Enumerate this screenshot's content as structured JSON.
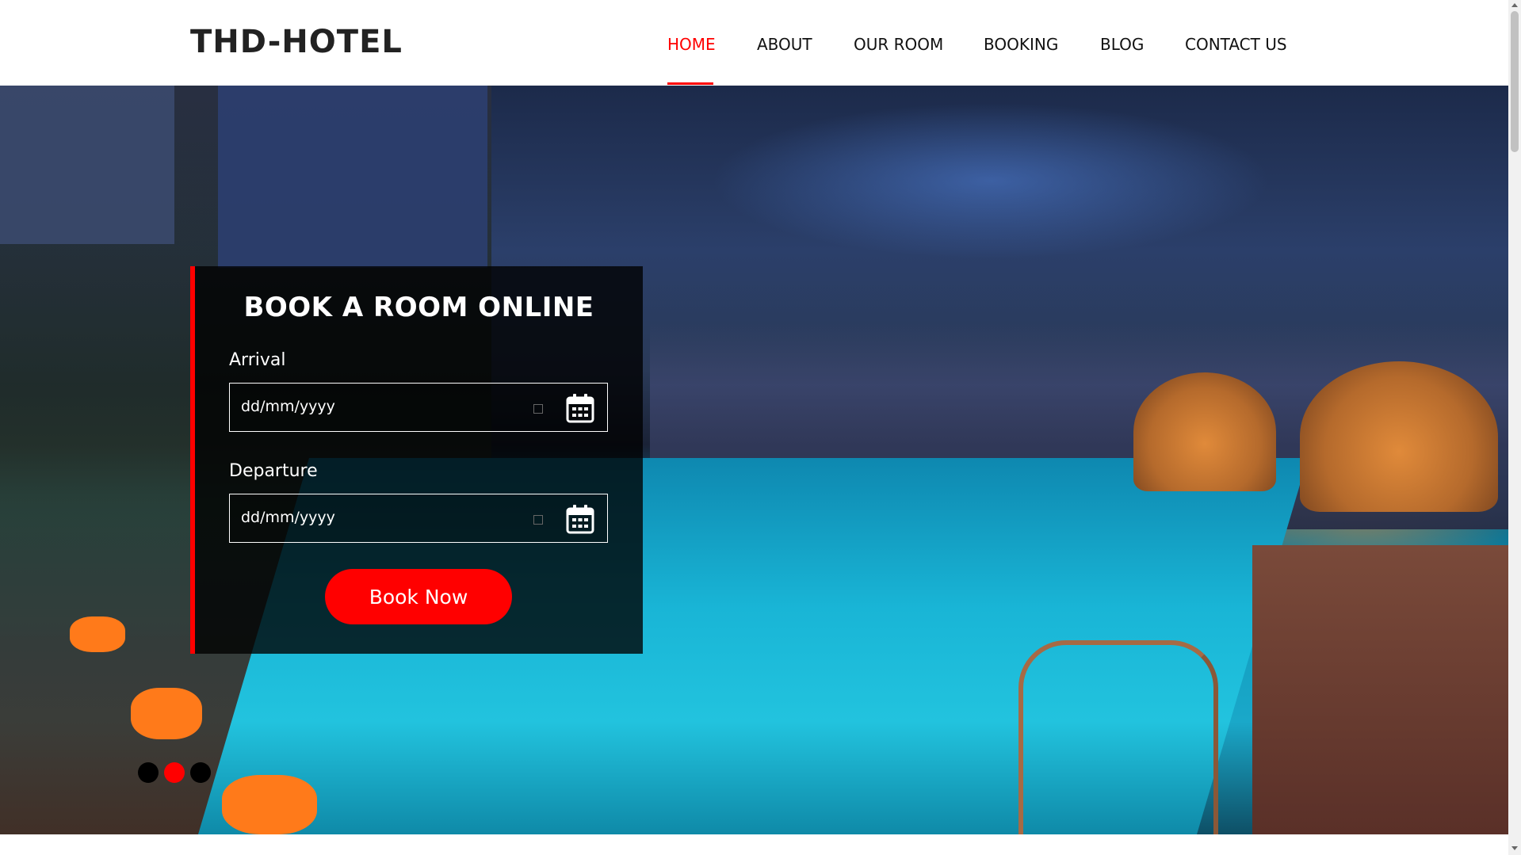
{
  "header": {
    "logo": "THD-HOTEL",
    "nav": [
      {
        "label": "HOME",
        "active": true
      },
      {
        "label": "ABOUT",
        "active": false
      },
      {
        "label": "OUR ROOM",
        "active": false
      },
      {
        "label": "BOOKING",
        "active": false
      },
      {
        "label": "BLOG",
        "active": false
      },
      {
        "label": "CONTACT US",
        "active": false
      }
    ]
  },
  "booking": {
    "title": "BOOK A ROOM ONLINE",
    "arrival": {
      "label": "Arrival",
      "placeholder": "dd/mm/yyyy",
      "icon": "calendar-icon"
    },
    "departure": {
      "label": "Departure",
      "placeholder": "dd/mm/yyyy",
      "icon": "calendar-icon"
    },
    "submit_label": "Book Now"
  },
  "slider": {
    "dots": 3,
    "active_index": 1
  },
  "colors": {
    "accent": "#ff0000",
    "nav_text": "#111111",
    "panel_bg": "rgba(0,0,0,0.78)"
  }
}
